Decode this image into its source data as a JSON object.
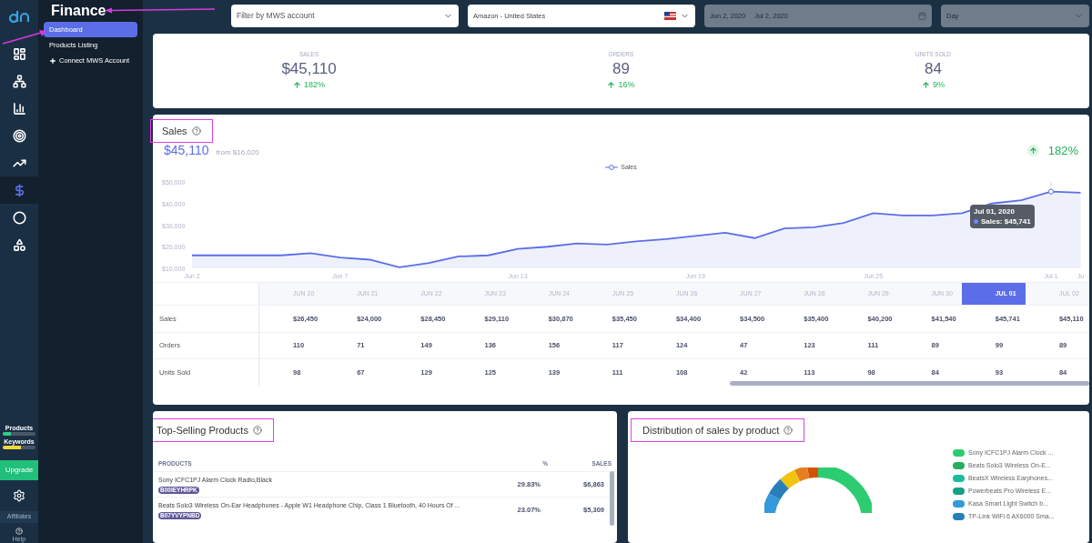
{
  "rail": {
    "items": [
      {
        "kind": "grid",
        "selected": false
      },
      {
        "kind": "hierarchy",
        "selected": false
      },
      {
        "kind": "bars",
        "selected": false
      },
      {
        "kind": "target",
        "selected": false
      },
      {
        "kind": "trend",
        "selected": false
      },
      {
        "kind": "dollar",
        "selected": true
      },
      {
        "kind": "ring",
        "selected": false
      },
      {
        "kind": "shapes",
        "selected": false
      }
    ],
    "meters": [
      {
        "label": "Products",
        "level": 0.25,
        "color": "#2ecc8f"
      },
      {
        "label": "Keywords",
        "level": 0.55,
        "color": "#f1d43a"
      }
    ],
    "upgrade": "Upgrade",
    "affiliates": "Affiliates",
    "help": "Help"
  },
  "submenu": {
    "title": "Finance",
    "items": [
      {
        "label": "Dashboard",
        "selected": true,
        "kind": "link"
      },
      {
        "label": "Products Listing",
        "selected": false,
        "kind": "link"
      },
      {
        "label": "Connect MWS Account",
        "selected": false,
        "kind": "add"
      }
    ]
  },
  "filters": {
    "account": {
      "placeholder": "Filter by MWS account"
    },
    "marketplace": {
      "value": "Amazon - United States"
    },
    "date_range": {
      "start": "Jun 2, 2020",
      "end": "Jul 2, 2020",
      "disabled": true
    },
    "interval": {
      "value": "Day",
      "disabled": true
    }
  },
  "kpis": [
    {
      "label": "SALES",
      "value": "$45,110",
      "change": "182%"
    },
    {
      "label": "ORDERS",
      "value": "89",
      "change": "16%"
    },
    {
      "label": "UNITS SOLD",
      "value": "84",
      "change": "9%"
    }
  ],
  "sales": {
    "title": "Sales",
    "total": "$45,110",
    "from": "from $16,020",
    "change": "182%",
    "tooltip": {
      "title": "Jul 01, 2020",
      "text": "Sales: $45,741"
    },
    "chart_data": {
      "type": "area",
      "categories": [
        "Jun 2",
        null,
        null,
        null,
        null,
        "Jun 7",
        null,
        null,
        null,
        null,
        null,
        "Jun 13",
        null,
        null,
        null,
        null,
        null,
        "Jun 19",
        null,
        null,
        null,
        null,
        null,
        "Jun 25",
        null,
        null,
        null,
        null,
        null,
        "Jul 1",
        "Ju"
      ],
      "series": [
        {
          "name": "Sales",
          "color": "#5b6ee8",
          "values": [
            16000,
            16000,
            16000,
            16000,
            17000,
            15000,
            14000,
            10500,
            12500,
            15500,
            16000,
            19000,
            20000,
            21500,
            21000,
            22500,
            23500,
            25000,
            26500,
            24000,
            28500,
            29000,
            31000,
            35500,
            34500,
            34500,
            35500,
            40000,
            41500,
            45500,
            45000
          ]
        }
      ],
      "ylim": [
        10000,
        50000
      ],
      "yticks": [
        {
          "value": 10000,
          "label": "$10,000"
        },
        {
          "value": 20000,
          "label": "$20,000"
        },
        {
          "value": 30000,
          "label": "$30,000"
        },
        {
          "value": 40000,
          "label": "$40,000"
        },
        {
          "value": 50000,
          "label": "$50,000"
        }
      ]
    },
    "table": {
      "columns": [
        {
          "label": "JUN 20",
          "selected": false
        },
        {
          "label": "JUN 21",
          "selected": false
        },
        {
          "label": "JUN 22",
          "selected": false
        },
        {
          "label": "JUN 23",
          "selected": false
        },
        {
          "label": "JUN 24",
          "selected": false
        },
        {
          "label": "JUN 25",
          "selected": false
        },
        {
          "label": "JUN 26",
          "selected": false
        },
        {
          "label": "JUN 27",
          "selected": false
        },
        {
          "label": "JUN 28",
          "selected": false
        },
        {
          "label": "JUN 29",
          "selected": false
        },
        {
          "label": "JUN 30",
          "selected": false
        },
        {
          "label": "JUL 01",
          "selected": true
        },
        {
          "label": "JUL 02",
          "selected": false
        }
      ],
      "rows": [
        {
          "label": "Sales",
          "cells": [
            "$26,450",
            "$24,000",
            "$28,450",
            "$29,110",
            "$30,870",
            "$35,450",
            "$34,400",
            "$34,500",
            "$35,400",
            "$40,200",
            "$41,540",
            "$45,741",
            "$45,110"
          ]
        },
        {
          "label": "Orders",
          "cells": [
            "110",
            "71",
            "149",
            "136",
            "156",
            "117",
            "124",
            "47",
            "123",
            "111",
            "89",
            "99",
            "89"
          ]
        },
        {
          "label": "Units Sold",
          "cells": [
            "98",
            "67",
            "129",
            "125",
            "139",
            "111",
            "108",
            "42",
            "113",
            "98",
            "84",
            "93",
            "84"
          ]
        }
      ]
    }
  },
  "top_products": {
    "title": "Top-Selling Products",
    "columns": [
      "PRODUCTS",
      "%",
      "SALES"
    ],
    "rows": [
      {
        "name": "Sony ICFC1PJ Alarm Clock Radio,Black",
        "asin": "B00IEYHRPK",
        "percent": "29.83%",
        "sales": "$6,863"
      },
      {
        "name": "Beats Solo3 Wireless On-Ear Headphones - Apple W1 Headphone Chip, Class 1 Bluetooth, 40 Hours Of ...",
        "asin": "B07YVYPNBD",
        "percent": "23.07%",
        "sales": "$5,309"
      }
    ]
  },
  "distribution": {
    "title": "Distribution of sales by product",
    "legend": [
      {
        "label": "Sony ICFC1PJ Alarm Clock ...",
        "color": "#2ecc71"
      },
      {
        "label": "Beats Solo3 Wireless On-E...",
        "color": "#27ae60"
      },
      {
        "label": "BeatsX Wireless Earphones...",
        "color": "#1abc9c"
      },
      {
        "label": "Powerbeats Pro Wireless E...",
        "color": "#16a085"
      },
      {
        "label": "Kasa Smart Light Switch b...",
        "color": "#3498db"
      },
      {
        "label": "TP-Link WiFi 6 AX6000 Sma...",
        "color": "#2980b9"
      }
    ]
  }
}
